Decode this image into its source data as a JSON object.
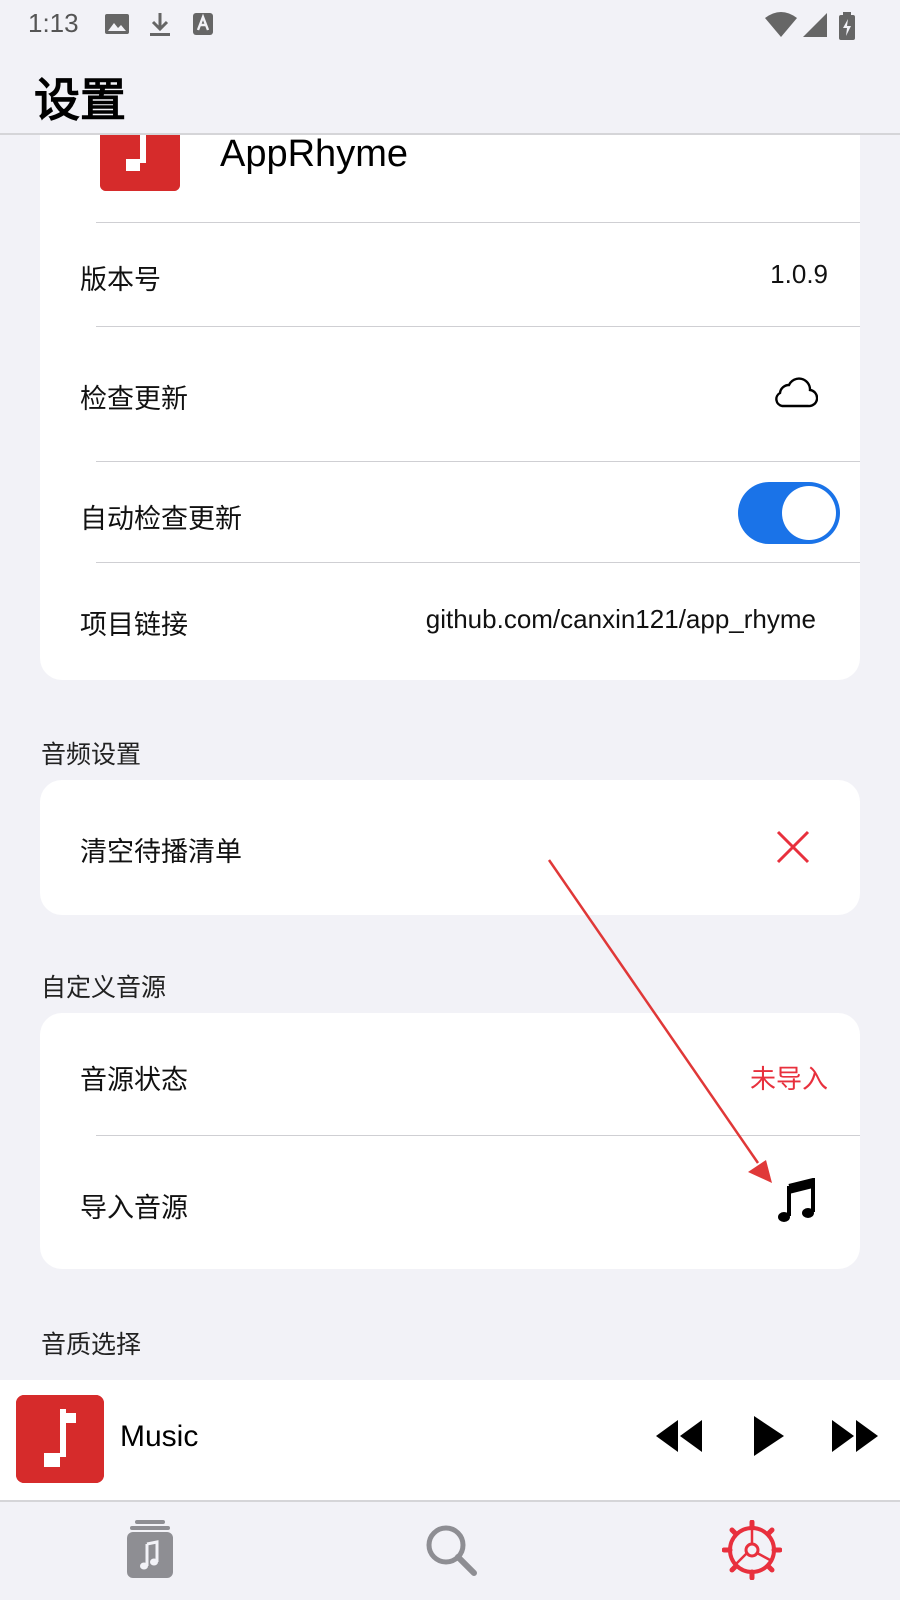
{
  "status_bar": {
    "time": "1:13",
    "left_icons": [
      "image-icon",
      "download-icon",
      "text-a-icon"
    ],
    "right_icons": [
      "wifi-icon",
      "signal-icon",
      "battery-icon"
    ]
  },
  "header": {
    "title": "设置"
  },
  "about_card": {
    "app_name": "AppRhyme",
    "version_label": "版本号",
    "version_value": "1.0.9",
    "check_update_label": "检查更新",
    "auto_check_label": "自动检查更新",
    "auto_check_enabled": true,
    "project_link_label": "项目链接",
    "project_link_value": "github.com/canxin121/app_rhyme"
  },
  "audio_section": {
    "title": "音频设置",
    "clear_queue_label": "清空待播清单"
  },
  "source_section": {
    "title": "自定义音源",
    "status_label": "音源状态",
    "status_value": "未导入",
    "import_label": "导入音源"
  },
  "quality_section": {
    "title": "音质选择"
  },
  "player": {
    "track_title": "Music"
  },
  "colors": {
    "accent_red": "#e8303d",
    "toggle_blue": "#1a73e8",
    "logo_red": "#d62b2b",
    "background": "#f2f2f7"
  }
}
